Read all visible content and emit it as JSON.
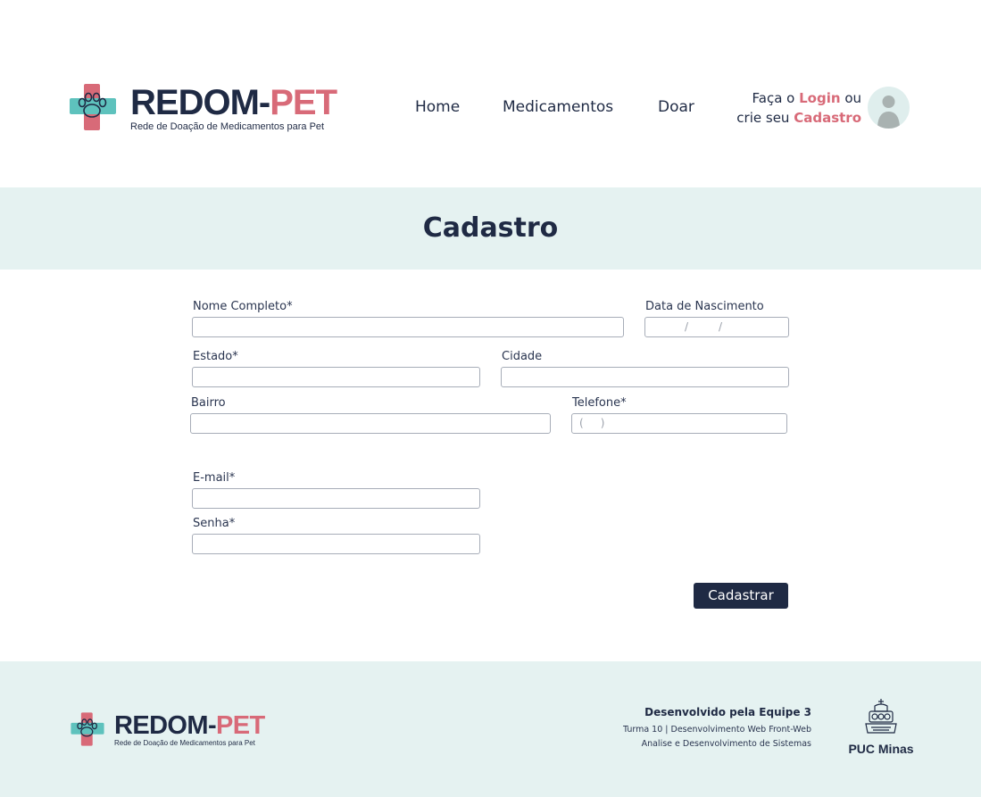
{
  "header": {
    "brand_part1": "REDOM-",
    "brand_part2": "PET",
    "tagline": "Rede de Doação de Medicamentos para Pet",
    "nav": {
      "home": "Home",
      "medicamentos": "Medicamentos",
      "doar": "Doar"
    },
    "auth": {
      "line1_prefix": "Faça o ",
      "login_link": "Login",
      "line1_suffix": " ou",
      "line2_prefix": "crie seu ",
      "cadastro_link": "Cadastro"
    }
  },
  "page_title": "Cadastro",
  "form": {
    "nome_label": "Nome Completo*",
    "nascimento_label": "Data de Nascimento",
    "date_sep": "/",
    "estado_label": "Estado*",
    "cidade_label": "Cidade",
    "bairro_label": "Bairro",
    "telefone_label": "Telefone*",
    "telefone_mask": "(     )",
    "email_label": "E-mail*",
    "senha_label": "Senha*",
    "submit_label": "Cadastrar"
  },
  "footer": {
    "brand_part1": "REDOM-",
    "brand_part2": "PET",
    "tagline": "Rede de Doação de Medicamentos para Pet",
    "credits_title": "Desenvolvido pela Equipe 3",
    "credits_line1": "Turma 10 | Desenvolvimento Web Front-Web",
    "credits_line2": "Analise e Desenvolvimento de Sistemas",
    "university": "PUC Minas"
  },
  "colors": {
    "navy": "#1f2a44",
    "pink": "#d86a78",
    "teal": "#5ec2bd",
    "band": "#e5f2f1"
  }
}
